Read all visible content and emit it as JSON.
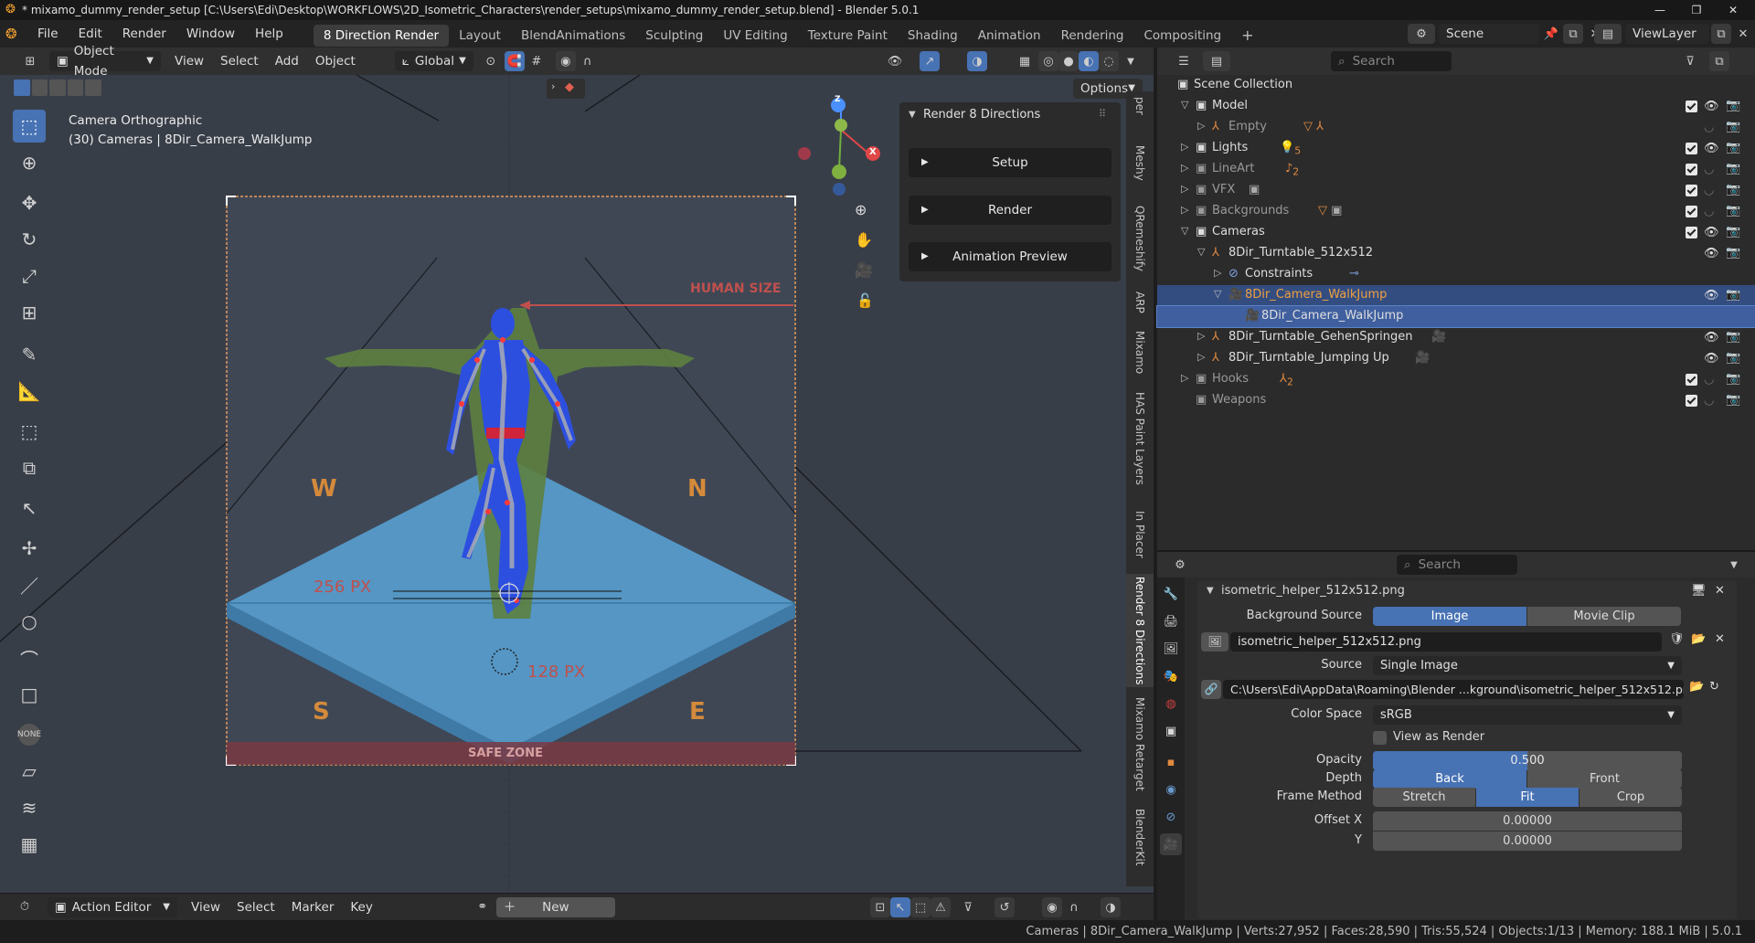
{
  "title_bar": {
    "title": "* mixamo_dummy_render_setup [C:\\Users\\Edi\\Desktop\\WORKFLOWS\\2D_Isometric_Characters\\render_setups\\mixamo_dummy_render_setup.blend] - Blender 5.0.1"
  },
  "menu": [
    "File",
    "Edit",
    "Render",
    "Window",
    "Help"
  ],
  "workspaces": [
    "8 Direction Render",
    "Layout",
    "BlendAnimations",
    "Sculpting",
    "UV Editing",
    "Texture Paint",
    "Shading",
    "Animation",
    "Rendering",
    "Compositing"
  ],
  "active_workspace": "8 Direction Render",
  "scene_name": "Scene",
  "view_layer": "ViewLayer",
  "viewport_header": {
    "mode": "Object Mode",
    "menus": [
      "View",
      "Select",
      "Add",
      "Object"
    ],
    "orientation": "Global",
    "options_label": "Options"
  },
  "viewport": {
    "camera_type": "Camera Orthographic",
    "camera_info": "(30) Cameras | 8Dir_Camera_WalkJump",
    "overlay_labels": {
      "human_size": "HUMAN SIZE",
      "w": "W",
      "n": "N",
      "s": "S",
      "e": "E",
      "px256": "256 PX",
      "px128": "128 PX",
      "safe_zone": "SAFE ZONE"
    },
    "gizmo": {
      "z": "Z",
      "x": "X"
    }
  },
  "npanel": {
    "title": "Render 8 Directions",
    "buttons": [
      "Setup",
      "Render",
      "Animation Preview"
    ]
  },
  "side_tabs": [
    "Meshy",
    "QRemeshify",
    "ARP",
    "Mixamo",
    "HAS Paint Layers",
    "In Placer",
    "Render 8 Directions",
    "Mixamo Retarget",
    "BlenderKit"
  ],
  "active_side_tab": "Render 8 Directions",
  "bottom_header": {
    "editor": "Action Editor",
    "menus": [
      "View",
      "Select",
      "Marker",
      "Key"
    ],
    "new_label": "New"
  },
  "outliner": {
    "search_placeholder": "Search",
    "root": "Scene Collection",
    "rows": [
      {
        "label": "Model",
        "indent": 0,
        "expanded": true
      },
      {
        "label": "Empty",
        "indent": 1,
        "dim": true
      },
      {
        "label": "Lights",
        "indent": 0,
        "badge": "5"
      },
      {
        "label": "LineArt",
        "indent": 0,
        "dim": true,
        "badge": "2"
      },
      {
        "label": "VFX",
        "indent": 0,
        "dim": true
      },
      {
        "label": "Backgrounds",
        "indent": 0,
        "dim": true
      },
      {
        "label": "Cameras",
        "indent": 0,
        "expanded": true
      },
      {
        "label": "8Dir_Turntable_512x512",
        "indent": 1,
        "expanded": true
      },
      {
        "label": "Constraints",
        "indent": 2
      },
      {
        "label": "8Dir_Camera_WalkJump",
        "indent": 2,
        "expanded": true,
        "active": true
      },
      {
        "label": "8Dir_Camera_WalkJump",
        "indent": 3,
        "selected": true
      },
      {
        "label": "8Dir_Turntable_GehenSpringen",
        "indent": 1
      },
      {
        "label": "8Dir_Turntable_Jumping Up",
        "indent": 1
      },
      {
        "label": "Hooks",
        "indent": 0,
        "dim": true,
        "badge": "2"
      },
      {
        "label": "Weapons",
        "indent": 0,
        "dim": true
      }
    ]
  },
  "properties": {
    "search_placeholder": "Search",
    "panel_title": "isometric_helper_512x512.png",
    "background_source_label": "Background Source",
    "background_source_options": [
      "Image",
      "Movie Clip"
    ],
    "image_name": "isometric_helper_512x512.png",
    "source_label": "Source",
    "source_value": "Single Image",
    "filepath": "C:\\Users\\Edi\\AppData\\Roaming\\Blender ...kground\\isometric_helper_512x512.png",
    "color_space_label": "Color Space",
    "color_space_value": "sRGB",
    "view_as_render": "View as Render",
    "opacity_label": "Opacity",
    "opacity_value": "0.500",
    "opacity_fraction": 0.5,
    "depth_label": "Depth",
    "depth_options": [
      "Back",
      "Front"
    ],
    "frame_method_label": "Frame Method",
    "frame_method_options": [
      "Stretch",
      "Fit",
      "Crop"
    ],
    "offset_x_label": "Offset X",
    "offset_x_value": "0.00000",
    "offset_y_label": "Y",
    "offset_y_value": "0.00000"
  },
  "status_bar": "Cameras | 8Dir_Camera_WalkJump | Verts:27,952 | Faces:28,590 | Tris:55,524 | Objects:1/13 | Memory: 188.1 MiB | 5.0.1",
  "colors": {
    "accent": "#4772b3",
    "selected_row": "#334d80",
    "viewport_bg": "#383e48",
    "helper_red": "#c0504d",
    "helper_orange": "#d48a3a",
    "character_blue": "#2d4fe0"
  }
}
